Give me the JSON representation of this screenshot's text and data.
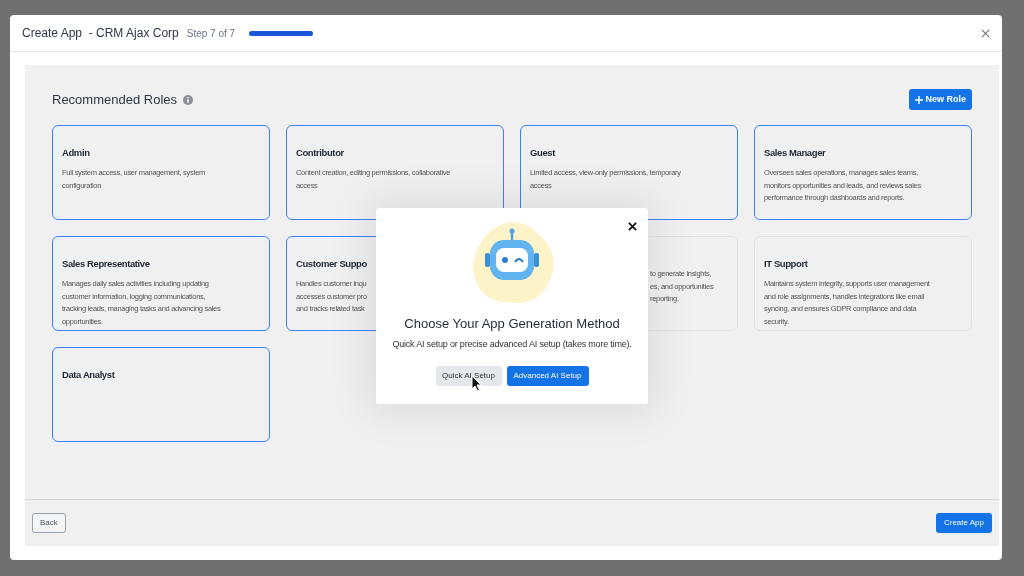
{
  "window": {
    "title": "Create App  - CRM Ajax Corp",
    "step": "Step 7 of 7",
    "progress": {
      "level": 1
    }
  },
  "section": {
    "title": "Recommended Roles",
    "new_role_button": "New Role"
  },
  "roles": [
    {
      "kind": "full",
      "title": "Admin",
      "lines": [
        "Full system access, user management, system",
        "configuration"
      ],
      "selected": true
    },
    {
      "kind": "full",
      "title": "Contributor",
      "lines": [
        "Content creation, editing permissions, collaborative",
        "access"
      ],
      "selected": true
    },
    {
      "kind": "full",
      "title": "Guest",
      "lines": [
        "Limited access, view-only permissions, temporary",
        "access"
      ],
      "selected": true
    },
    {
      "kind": "full",
      "title": "Sales Manager",
      "lines": [
        "Oversees sales operations, manages sales teams,",
        "monitors opportunities and leads, and reviews sales",
        "performance through dashboards and reports."
      ],
      "selected": true
    },
    {
      "kind": "full",
      "title": "Sales Representative",
      "lines": [
        "Manages daily sales activities including updating",
        "customer information, logging communications,",
        "tracking leads, managing tasks and advancing sales",
        "opportunities."
      ],
      "selected": true
    },
    {
      "kind": "full",
      "title": "Customer Suppo",
      "lines": [
        "Handles customer inqu",
        "accesses customer pro",
        "and tracks related task"
      ],
      "selected": true
    },
    {
      "kind": "tail",
      "lines": [
        "to generate insights,",
        "es, and opportunities",
        "reporting."
      ],
      "selected": false
    },
    {
      "kind": "full",
      "title": "IT Support",
      "lines": [
        "Maintains system integrity, supports user management",
        "and role assignments, handles integrations like email",
        "syncing, and ensures GDPR compliance and data",
        "security."
      ],
      "selected": false
    },
    {
      "kind": "full",
      "title": "Data Analyst",
      "selected": true
    }
  ],
  "footer": {
    "back": "Back",
    "create": "Create App"
  },
  "dialog": {
    "title": "Choose Your App Generation Method",
    "subtitle": "Quick AI setup or precise advanced AI setup (takes more time).",
    "quick": "Quick AI Setup",
    "advanced": "Advanced AI Setup"
  }
}
